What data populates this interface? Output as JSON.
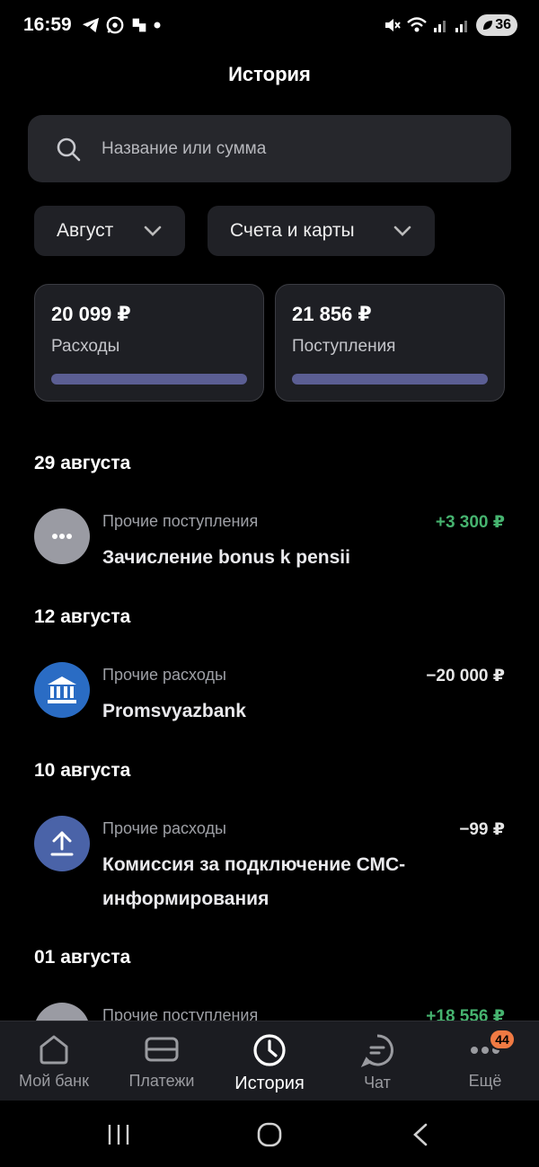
{
  "status_bar": {
    "time": "16:59",
    "battery": "36"
  },
  "header": {
    "title": "История"
  },
  "search": {
    "placeholder": "Название или сумма"
  },
  "filters": [
    {
      "label": "Август"
    },
    {
      "label": "Счета и карты"
    }
  ],
  "summary": [
    {
      "amount": "20 099 ₽",
      "label": "Расходы"
    },
    {
      "amount": "21 856 ₽",
      "label": "Поступления"
    }
  ],
  "groups": [
    {
      "date": "29 августа",
      "transactions": [
        {
          "category": "Прочие поступления",
          "name": "Зачисление bonus k pensii",
          "amount": "+3 300 ₽",
          "icon": "more-icon"
        }
      ]
    },
    {
      "date": "12 августа",
      "transactions": [
        {
          "category": "Прочие расходы",
          "name": "Promsvyazbank",
          "amount": "−20 000 ₽",
          "icon": "bank-icon"
        }
      ]
    },
    {
      "date": "10 августа",
      "transactions": [
        {
          "category": "Прочие расходы",
          "name": "Комиссия за подключение СМС-информирования",
          "amount": "−99 ₽",
          "icon": "upload-icon"
        }
      ]
    },
    {
      "date": "01 августа",
      "transactions": [
        {
          "category": "Прочие поступления",
          "name": "",
          "amount": "+18 556 ₽",
          "icon": "more-icon"
        }
      ]
    }
  ],
  "bottom_nav": [
    {
      "label": "Мой банк",
      "icon": "home-icon"
    },
    {
      "label": "Платежи",
      "icon": "card-icon"
    },
    {
      "label": "История",
      "icon": "clock-icon",
      "active": true
    },
    {
      "label": "Чат",
      "icon": "chat-icon"
    },
    {
      "label": "Ещё",
      "icon": "more-icon",
      "badge": "44"
    }
  ],
  "colors": {
    "positive": "#46b36f",
    "accent_bar": "#5b5e93",
    "bank_blue": "#2a6cc4",
    "upload_blue": "#4a63a8",
    "badge": "#f07a43"
  }
}
